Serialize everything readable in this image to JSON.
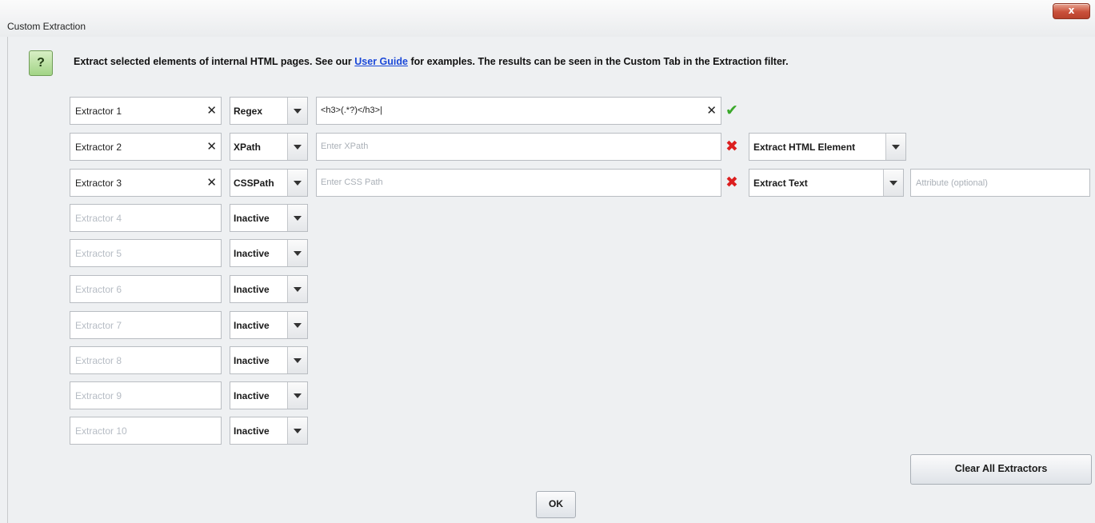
{
  "window": {
    "title": "Custom Extraction",
    "close_label": "x"
  },
  "help": {
    "icon_label": "?"
  },
  "intro": {
    "before_link": "Extract selected elements of internal HTML pages. See our ",
    "link_text": "User Guide",
    "after_link": " for examples. The results can be seen in the Custom Tab in the Extraction filter."
  },
  "extractors": [
    {
      "name": "Extractor 1",
      "type": "Regex",
      "expression": "<h3>(.*?)</h3>|",
      "status": "valid"
    },
    {
      "name": "Extractor 2",
      "type": "XPath",
      "placeholder": "Enter XPath",
      "status": "invalid",
      "mode": "Extract HTML Element"
    },
    {
      "name": "Extractor 3",
      "type": "CSSPath",
      "placeholder": "Enter CSS Path",
      "status": "invalid",
      "mode": "Extract Text",
      "attribute_placeholder": "Attribute (optional)"
    },
    {
      "name": "Extractor 4",
      "type": "Inactive"
    },
    {
      "name": "Extractor 5",
      "type": "Inactive"
    },
    {
      "name": "Extractor 6",
      "type": "Inactive"
    },
    {
      "name": "Extractor 7",
      "type": "Inactive"
    },
    {
      "name": "Extractor 8",
      "type": "Inactive"
    },
    {
      "name": "Extractor 9",
      "type": "Inactive"
    },
    {
      "name": "Extractor 10",
      "type": "Inactive"
    }
  ],
  "icons": {
    "clear": "✕",
    "valid": "✔",
    "invalid": "✖"
  },
  "colors": {
    "valid": "#3aa82a",
    "invalid": "#dc1f1f",
    "link": "#1a48d8",
    "inactive_text": "#b6bcc4"
  },
  "buttons": {
    "clear_all": "Clear All Extractors",
    "ok": "OK"
  }
}
